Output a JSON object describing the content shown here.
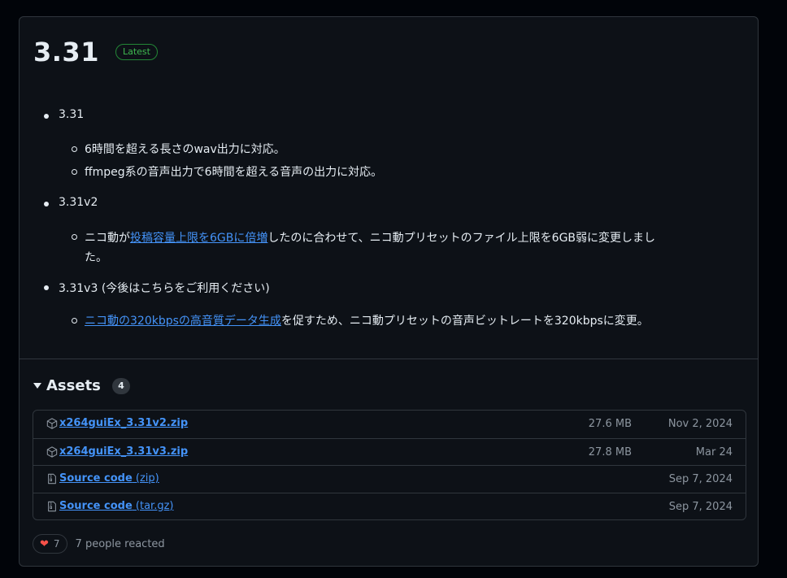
{
  "release": {
    "title": "3.31",
    "badge": "Latest"
  },
  "notes": [
    {
      "label": "3.31",
      "items": [
        {
          "segments": [
            {
              "text": "6時間を超える長さのwav出力に対応。"
            }
          ]
        },
        {
          "segments": [
            {
              "text": "ffmpeg系の音声出力で6時間を超える音声の出力に対応。"
            }
          ]
        }
      ]
    },
    {
      "label": "3.31v2",
      "items": [
        {
          "segments": [
            {
              "text": "ニコ動が"
            },
            {
              "text": "投稿容量上限を6GBに倍増",
              "link": true
            },
            {
              "text": "したのに合わせて、ニコ動プリセットのファイル上限を6GB弱に変更しまし"
            },
            {
              "text": "た。"
            }
          ]
        }
      ]
    },
    {
      "label": "3.31v3 (今後はこちらをご利用ください)",
      "items": [
        {
          "segments": [
            {
              "text": "ニコ動の320kbpsの高音質データ生成",
              "link": true
            },
            {
              "text": "を促すため、ニコ動プリセットの音声ビットレートを320kbpsに変更。"
            }
          ]
        }
      ]
    }
  ],
  "assets": {
    "title": "Assets",
    "count": "4",
    "rows": [
      {
        "icon": "package-icon",
        "name": "x264guiEx_3.31v2.zip",
        "ext": "",
        "size": "27.6 MB",
        "date": "Nov 2, 2024"
      },
      {
        "icon": "package-icon",
        "name": "x264guiEx_3.31v3.zip",
        "ext": "",
        "size": "27.8 MB",
        "date": "Mar 24"
      },
      {
        "icon": "file-zip-icon",
        "name": "Source code",
        "ext": " (zip)",
        "size": "",
        "date": "Sep 7, 2024"
      },
      {
        "icon": "file-zip-icon",
        "name": "Source code",
        "ext": " (tar.gz)",
        "size": "",
        "date": "Sep 7, 2024"
      }
    ]
  },
  "reactions": {
    "emoji_icon": "heart-icon",
    "count": "7",
    "text": "7 people reacted"
  }
}
